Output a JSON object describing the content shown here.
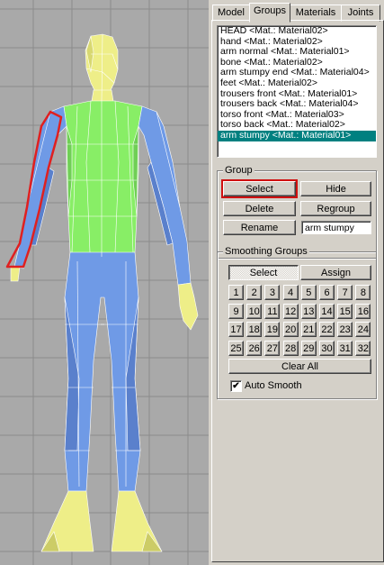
{
  "tabs": [
    {
      "label": "Model"
    },
    {
      "label": "Groups"
    },
    {
      "label": "Materials"
    },
    {
      "label": "Joints"
    }
  ],
  "active_tab": "Groups",
  "groups_list": [
    {
      "label": "HEAD <Mat.: Material02>"
    },
    {
      "label": "hand <Mat.: Material02>"
    },
    {
      "label": "arm normal <Mat.: Material01>"
    },
    {
      "label": "bone <Mat.: Material02>"
    },
    {
      "label": "arm stumpy end <Mat.: Material04>"
    },
    {
      "label": "feet <Mat.: Material02>"
    },
    {
      "label": "trousers front <Mat.: Material01>"
    },
    {
      "label": "trousers back <Mat.: Material04>"
    },
    {
      "label": "torso front <Mat.: Material03>"
    },
    {
      "label": "torso back <Mat.: Material02>"
    },
    {
      "label": "arm stumpy <Mat.: Material01>"
    }
  ],
  "selected_group": "arm stumpy <Mat.: Material01>",
  "group_box": {
    "title": "Group",
    "select_label": "Select",
    "hide_label": "Hide",
    "delete_label": "Delete",
    "regroup_label": "Regroup",
    "rename_label": "Rename",
    "name_value": "arm stumpy"
  },
  "smoothing_box": {
    "title": "Smoothing Groups",
    "select_label": "Select",
    "assign_label": "Assign",
    "numbers": [
      "1",
      "2",
      "3",
      "4",
      "5",
      "6",
      "7",
      "8",
      "9",
      "10",
      "11",
      "12",
      "13",
      "14",
      "15",
      "16",
      "17",
      "18",
      "19",
      "20",
      "21",
      "22",
      "23",
      "24",
      "25",
      "26",
      "27",
      "28",
      "29",
      "30",
      "31",
      "32"
    ],
    "clear_all_label": "Clear All",
    "auto_smooth_label": "Auto Smooth",
    "auto_smooth_checked": true
  },
  "colors": {
    "viewport_bg": "#a9a9a9",
    "torso": "#88ee66",
    "limbs": "#6f9ae6",
    "skin": "#eeee88",
    "selection": "#e02020",
    "list_highlight": "#008080"
  }
}
